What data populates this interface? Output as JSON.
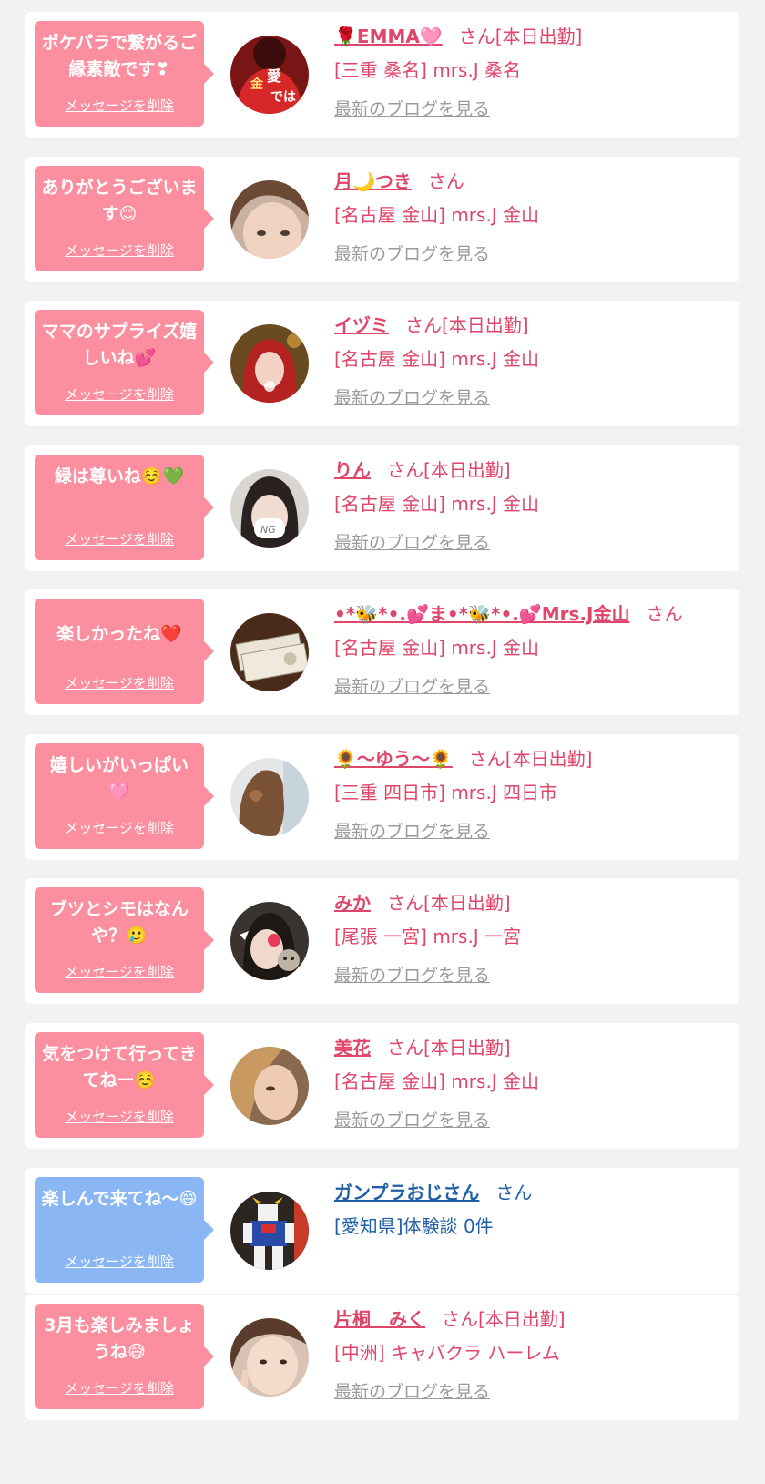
{
  "colors": {
    "pink_bubble": "#fb8fa0",
    "blue_bubble": "#8ab7f3",
    "pink_text": "#e0456a",
    "blue_text": "#1f5fa8",
    "blog_link": "#9a9a9a"
  },
  "cards": [
    {
      "message": "ポケパラで繋がるご縁素敵です❣",
      "delete_label": "メッセージを削除",
      "name": "🌹EMMA🩷",
      "suffix": "さん[本日出勤]",
      "shop": "[三重 桑名] mrs.J 桑名",
      "blog_label": "最新のブログを見る",
      "theme": "pink",
      "avatar_icon": "avatar-photo-red-shirt"
    },
    {
      "message": "ありがとうございます😊",
      "delete_label": "メッセージを削除",
      "name": "月🌙つき",
      "suffix": "さん",
      "shop": "[名古屋 金山] mrs.J 金山",
      "blog_label": "最新のブログを見る",
      "theme": "pink",
      "avatar_icon": "avatar-photo-brown-hair"
    },
    {
      "message": "ママのサプライズ嬉しいね💕",
      "delete_label": "メッセージを削除",
      "name": "イヅミ",
      "suffix": "さん[本日出勤]",
      "shop": "[名古屋 金山] mrs.J 金山",
      "blog_label": "最新のブログを見る",
      "theme": "pink",
      "avatar_icon": "avatar-photo-red-hair"
    },
    {
      "message": "緑は尊いね☺️💚",
      "delete_label": "メッセージを削除",
      "name": "りん",
      "suffix": "さん[本日出勤]",
      "shop": "[名古屋 金山] mrs.J 金山",
      "blog_label": "最新のブログを見る",
      "theme": "pink",
      "avatar_icon": "avatar-photo-ng-mask"
    },
    {
      "message": "楽しかったね❤️",
      "delete_label": "メッセージを削除",
      "name": "•*🐝*•.💕ま•*🐝*•.💕Mrs.J金山",
      "suffix": "さん",
      "shop": "[名古屋 金山] mrs.J 金山",
      "blog_label": "最新のブログを見る",
      "theme": "pink",
      "avatar_icon": "avatar-photo-banknotes"
    },
    {
      "message": "嬉しいがいっぱい🩷",
      "delete_label": "メッセージを削除",
      "name": "🌻〜ゆう〜🌻",
      "suffix": "さん[本日出勤]",
      "shop": "[三重 四日市] mrs.J 四日市",
      "blog_label": "最新のブログを見る",
      "theme": "pink",
      "avatar_icon": "avatar-photo-wavy-hair"
    },
    {
      "message": "ブツとシモはなんや？🥲",
      "delete_label": "メッセージを削除",
      "name": "みか",
      "suffix": "さん[本日出勤]",
      "shop": "[尾張 一宮] mrs.J 一宮",
      "blog_label": "最新のブログを見る",
      "theme": "pink",
      "avatar_icon": "avatar-photo-cat-sticker"
    },
    {
      "message": "気をつけて行ってきてねー☺️",
      "delete_label": "メッセージを削除",
      "name": "美花",
      "suffix": "さん[本日出勤]",
      "shop": "[名古屋 金山] mrs.J 金山",
      "blog_label": "最新のブログを見る",
      "theme": "pink",
      "avatar_icon": "avatar-photo-blonde"
    },
    {
      "message": "楽しんで来てね〜😄",
      "delete_label": "メッセージを削除",
      "name": "ガンプラおじさん",
      "suffix": "さん",
      "shop": "[愛知県]体験談 0件",
      "blog_label": "",
      "theme": "blue",
      "avatar_icon": "avatar-photo-gundam-model"
    },
    {
      "message": "3月も楽しみましょうね😅",
      "delete_label": "メッセージを削除",
      "name": "片桐　みく",
      "suffix": "さん[本日出勤]",
      "shop": "[中洲] キャバクラ ハーレム",
      "blog_label": "最新のブログを見る",
      "theme": "pink",
      "avatar_icon": "avatar-photo-peace-sign"
    }
  ]
}
